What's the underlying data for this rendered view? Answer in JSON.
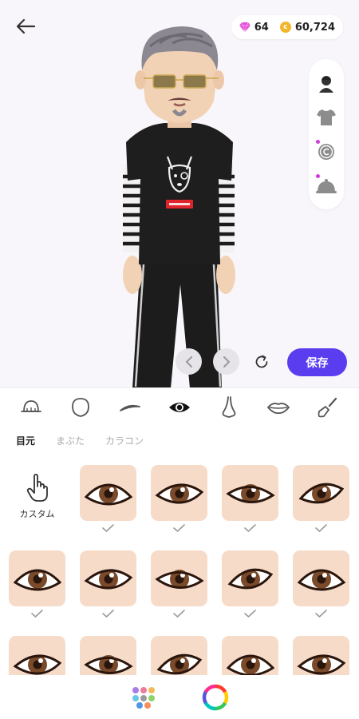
{
  "currency": {
    "gems": "64",
    "coins": "60,724",
    "coin_symbol": "c"
  },
  "avatar": {
    "shirt_text": "GOOD DOG"
  },
  "actions": {
    "save_label": "保存"
  },
  "side_toolbar": [
    "avatar-icon",
    "shirt-icon",
    "copyright-icon",
    "bell-icon"
  ],
  "categories": [
    "hat-icon",
    "face-icon",
    "eyebrow-icon",
    "eye-icon",
    "nose-icon",
    "lips-icon",
    "brush-icon"
  ],
  "subtabs": [
    {
      "label": "目元",
      "active": true
    },
    {
      "label": "まぶた",
      "active": false
    },
    {
      "label": "カラコン",
      "active": false
    }
  ],
  "custom": {
    "label": "カスタム"
  },
  "colors": {
    "accent": "#5b3df0",
    "skin": "#f7dbc9",
    "iris": "#7a4a2a"
  }
}
